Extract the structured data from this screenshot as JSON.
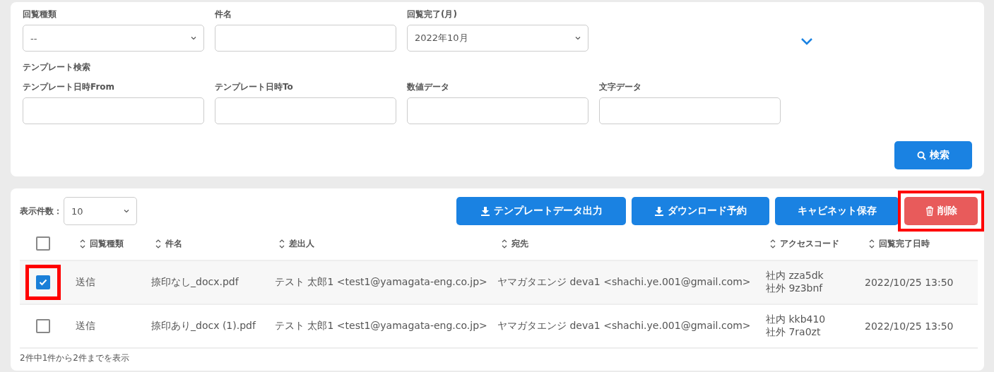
{
  "filters": [
    {
      "label": "回覧種類",
      "kind": "select",
      "value": "--"
    },
    {
      "label": "件名",
      "kind": "text"
    },
    {
      "label": "回覧完了(月)",
      "kind": "select",
      "value": "2022年10月"
    }
  ],
  "template_search": {
    "title": "テンプレート検索",
    "fields": [
      {
        "label": "テンプレート日時From"
      },
      {
        "label": "テンプレート日時To"
      },
      {
        "label": "数値データ"
      },
      {
        "label": "文字データ"
      }
    ]
  },
  "search_button": "検索",
  "page_size": {
    "label": "表示件数：",
    "value": "10"
  },
  "actions": [
    {
      "label": "テンプレートデータ出力",
      "kind": "download",
      "highlighted": false
    },
    {
      "label": "ダウンロード予約",
      "kind": "download",
      "highlighted": false
    },
    {
      "label": "キャビネット保存",
      "kind": "plain",
      "highlighted": false
    },
    {
      "label": "削除",
      "kind": "delete",
      "highlighted": true
    }
  ],
  "table": {
    "select_all_checked": false,
    "columns": [
      "回覧種類",
      "件名",
      "差出人",
      "宛先",
      "アクセスコード",
      "回覧完了日時"
    ],
    "rows": [
      {
        "checked": true,
        "highlighted": true,
        "type": "送信",
        "subject": "捺印なし_docx.pdf",
        "sender": "テスト 太郎1 <test1@yamagata-eng.co.jp>",
        "recipient": "ヤマガタエンジ deva1 <shachi.ye.001@gmail.com>",
        "access_codes": [
          "社内 zza5dk",
          "社外 9z3bnf"
        ],
        "completed": "2022/10/25 13:50"
      },
      {
        "checked": false,
        "highlighted": false,
        "type": "送信",
        "subject": "捺印あり_docx (1).pdf",
        "sender": "テスト 太郎1 <test1@yamagata-eng.co.jp>",
        "recipient": "ヤマガタエンジ deva1 <shachi.ye.001@gmail.com>",
        "access_codes": [
          "社内 kkb410",
          "社外 7ra0zt"
        ],
        "completed": "2022/10/25 13:50"
      }
    ]
  },
  "summary": "2件中1件から2件までを表示"
}
